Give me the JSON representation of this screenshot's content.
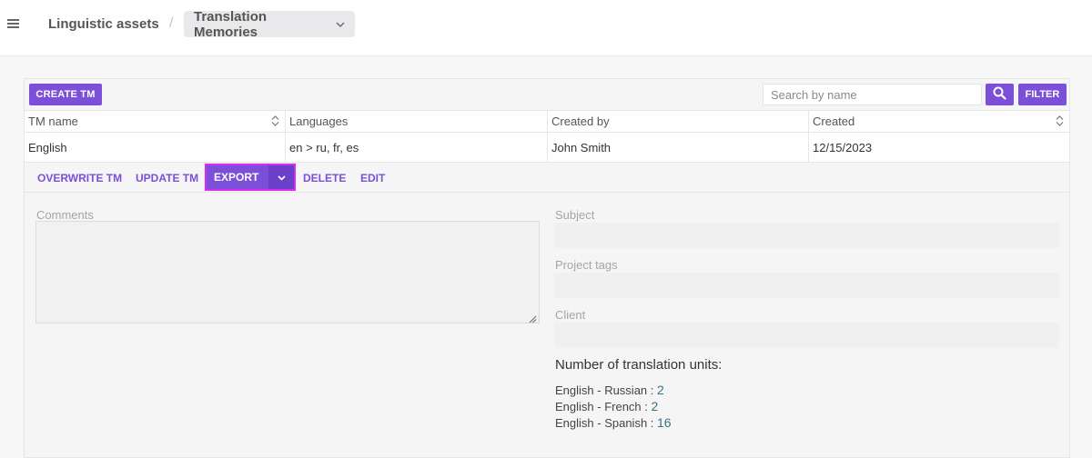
{
  "header": {
    "breadcrumb_root": "Linguistic assets",
    "breadcrumb_separator": "/",
    "breadcrumb_current": "Translation Memories"
  },
  "toolbar": {
    "create_label": "CREATE TM",
    "search_placeholder": "Search by name",
    "search_value": "",
    "filter_label": "FILTER"
  },
  "table": {
    "columns": [
      "TM name",
      "Languages",
      "Created by",
      "Created"
    ],
    "rows": [
      {
        "name": "English",
        "languages": "en > ru, fr, es",
        "created_by": "John Smith",
        "created": "12/15/2023"
      }
    ]
  },
  "actions": {
    "overwrite": "OVERWRITE TM",
    "update": "UPDATE TM",
    "export": "EXPORT",
    "delete": "DELETE",
    "edit": "EDIT"
  },
  "details": {
    "comments_label": "Comments",
    "comments_value": "",
    "subject_label": "Subject",
    "project_tags_label": "Project tags",
    "client_label": "Client",
    "units_title": "Number of translation units:",
    "units": [
      {
        "pair": "English - Russian",
        "sep": " : ",
        "count": "2"
      },
      {
        "pair": "English - French",
        "sep": " : ",
        "count": "2"
      },
      {
        "pair": "English - Spanish",
        "sep": " : ",
        "count": "16"
      }
    ]
  },
  "colors": {
    "accent": "#7b4fd8",
    "highlight_border": "#d92bf0",
    "unit_count": "#3f6f86"
  },
  "icons": {
    "menu": "hamburger-icon",
    "breadcrumb_dropdown": "chevron-down-icon",
    "search": "search-icon",
    "sort": "sort-icon",
    "export_dropdown": "chevron-down-icon",
    "resize": "resize-grip-icon"
  }
}
